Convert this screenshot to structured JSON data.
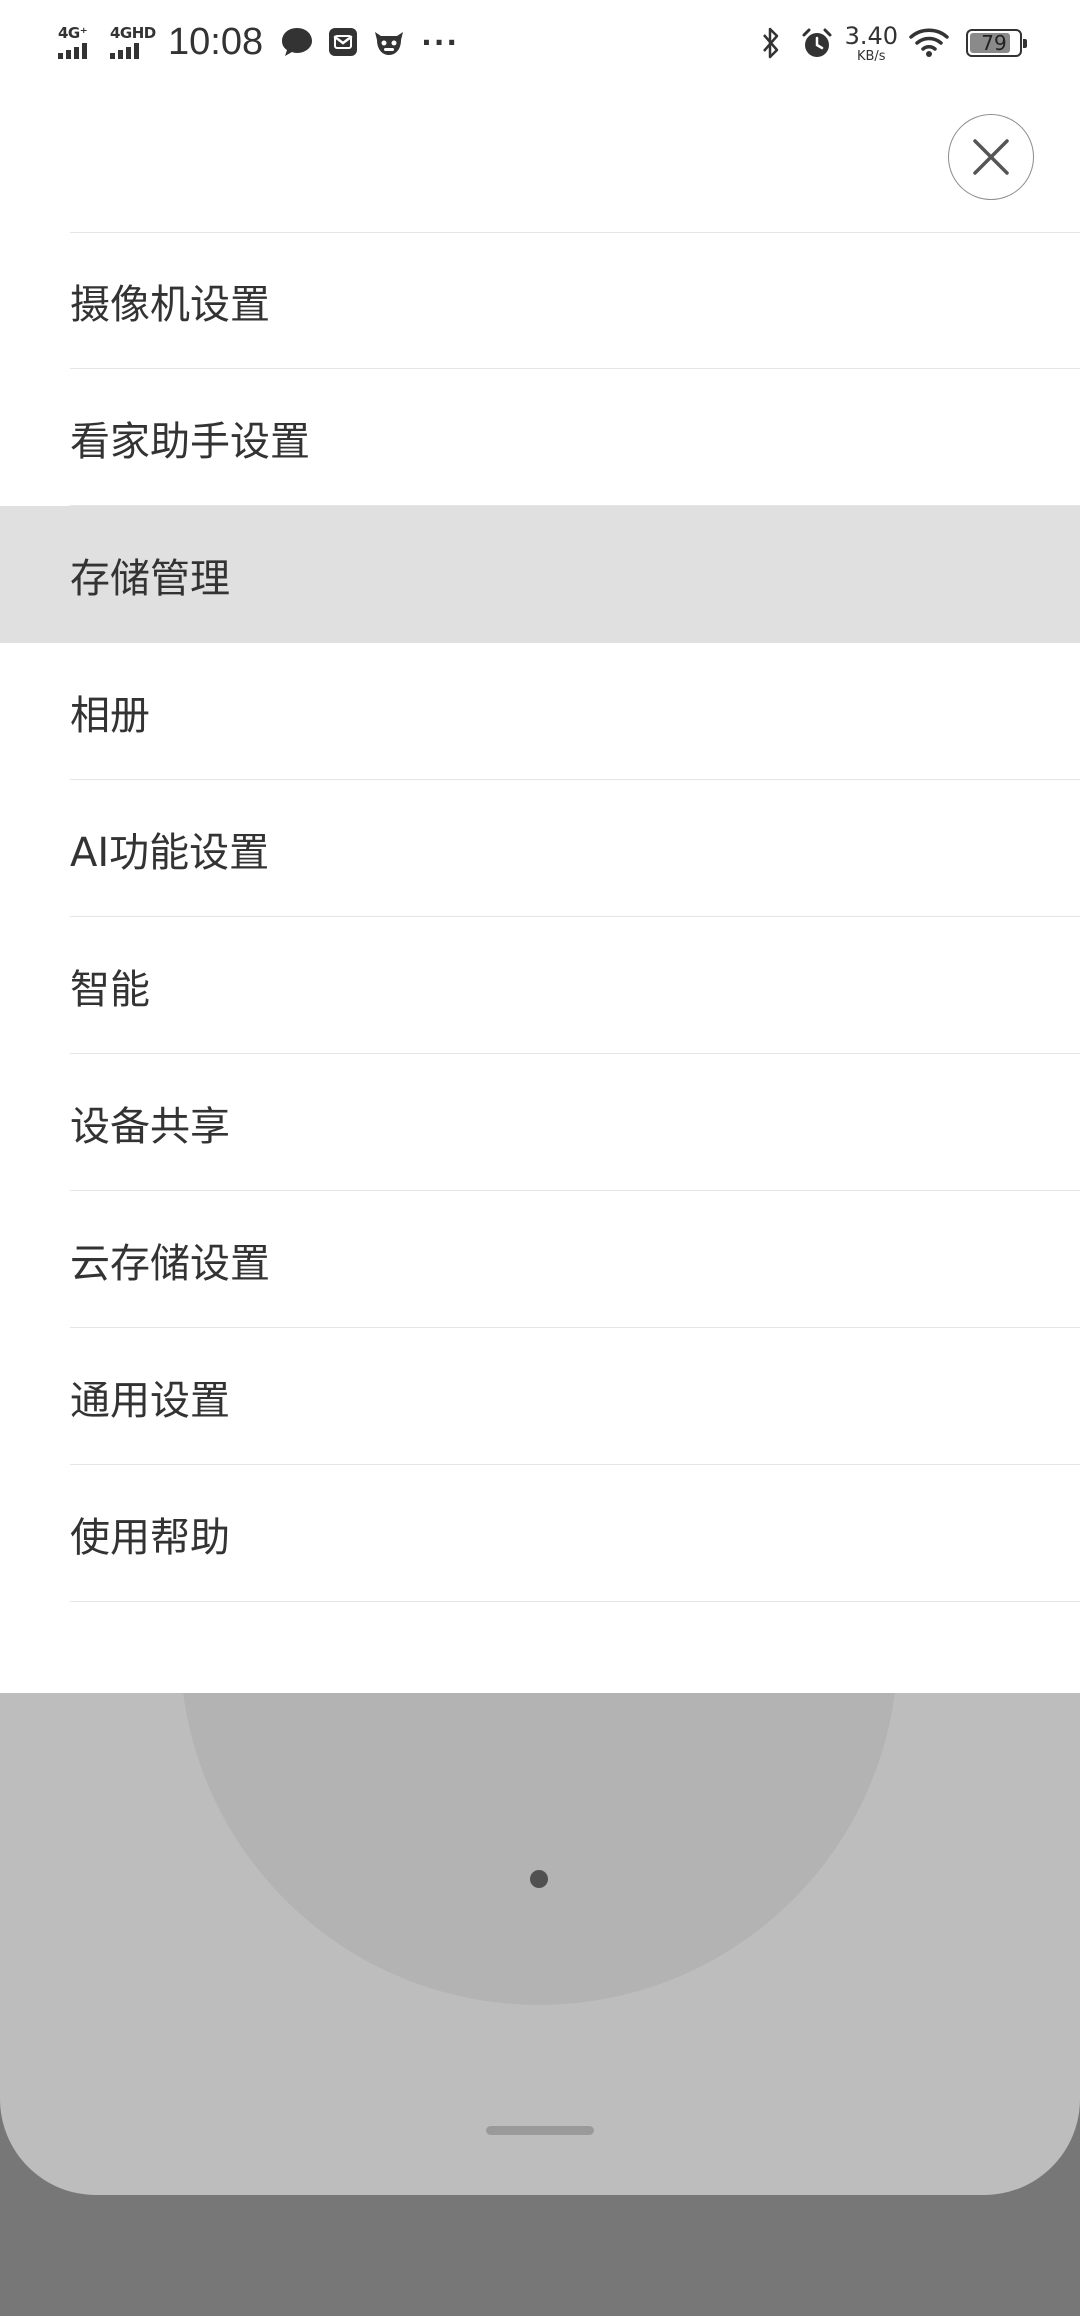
{
  "status_bar": {
    "network1": "4G⁺",
    "network2": "4GHD",
    "time": "10:08",
    "speed_value": "3.40",
    "speed_unit": "KB/s",
    "battery": "79",
    "battery_level": 0.79,
    "icons": [
      "chat-bubble-icon",
      "mail-icon",
      "ox-mascot-icon",
      "more-dots-icon",
      "bluetooth-icon",
      "alarm-icon",
      "wifi-icon",
      "battery-icon"
    ]
  },
  "close_button": {
    "icon": "close-icon"
  },
  "menu": {
    "items": [
      {
        "label": "摄像机设置"
      },
      {
        "label": "看家助手设置"
      },
      {
        "label": "存储管理"
      },
      {
        "label": "相册"
      },
      {
        "label": "AI功能设置"
      },
      {
        "label": "智能"
      },
      {
        "label": "设备共享"
      },
      {
        "label": "云存储设置"
      },
      {
        "label": "通用设置"
      },
      {
        "label": "使用帮助"
      }
    ],
    "highlighted_index": 2
  },
  "colors": {
    "panel": "#ffffff",
    "highlight": "#e0e0e0",
    "text": "#333333",
    "sheet": "#bdbdbd",
    "backdrop": "#777777"
  }
}
